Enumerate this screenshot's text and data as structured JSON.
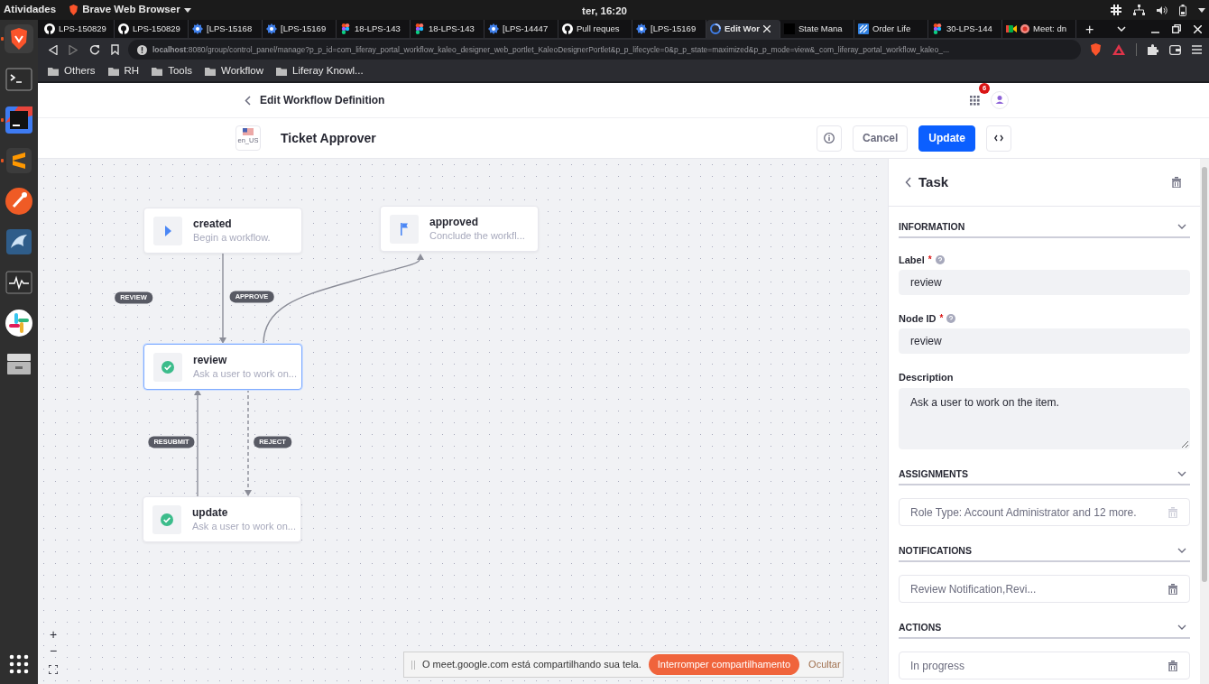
{
  "system_bar": {
    "activities": "Atividades",
    "app_menu": "Brave Web Browser",
    "clock": "ter, 16:20"
  },
  "dock": [
    {
      "kind": "brave",
      "running": true
    },
    {
      "kind": "terminal",
      "running": false
    },
    {
      "kind": "ide",
      "running": true
    },
    {
      "kind": "editor",
      "running": true
    },
    {
      "kind": "round",
      "running": false
    },
    {
      "kind": "database",
      "running": false
    },
    {
      "kind": "monitor",
      "running": false
    },
    {
      "kind": "pinwheel",
      "running": false
    },
    {
      "kind": "drawer",
      "running": false
    }
  ],
  "browser": {
    "tabs": [
      {
        "title": "LPS-150829",
        "kind": "github",
        "selected": false
      },
      {
        "title": "LPS-150829",
        "kind": "github",
        "selected": false
      },
      {
        "title": "[LPS-15168",
        "kind": "gear",
        "selected": false
      },
      {
        "title": "[LPS-15169",
        "kind": "gear",
        "selected": false
      },
      {
        "title": "18-LPS-143",
        "kind": "figma",
        "selected": false
      },
      {
        "title": "18-LPS-143",
        "kind": "figma",
        "selected": false
      },
      {
        "title": "[LPS-14447",
        "kind": "gear",
        "selected": false
      },
      {
        "title": "Pull reques",
        "kind": "github",
        "selected": false
      },
      {
        "title": "[LPS-15169",
        "kind": "gear",
        "selected": false
      },
      {
        "title": "Edit Wor",
        "kind": "spinner",
        "selected": true
      },
      {
        "title": "State Mana",
        "kind": "blank",
        "selected": false
      },
      {
        "title": "Order Life",
        "kind": "grid",
        "selected": false
      },
      {
        "title": "30-LPS-144",
        "kind": "figma",
        "selected": false
      },
      {
        "title": "Meet: dn",
        "kind": "meet",
        "selected": false
      }
    ],
    "new_tab": "+",
    "url": "**localhost**:8080/group/control_panel/manage?p_p_id=com_liferay_portal_workflow_kaleo_designer_web_portlet_KaleoDesignerPortlet&p_p_lifecycle=0&p_p_state=maximized&p_p_mode=view&_com_liferay_portal_workflow_kaleo_...",
    "bookmarks": [
      "Others",
      "RH",
      "Tools",
      "Workflow",
      "Liferay Knowl..."
    ]
  },
  "page": {
    "header_title": "Edit Workflow Definition",
    "notification_count": "6",
    "locale": "en_US",
    "title": "Ticket Approver",
    "cancel": "Cancel",
    "update": "Update"
  },
  "canvas": {
    "nodes": [
      {
        "kind": "start",
        "label": "created",
        "description": "Begin a workflow.",
        "selected": false
      },
      {
        "kind": "end",
        "label": "approved",
        "description": "Conclude the workfl...",
        "selected": false
      },
      {
        "kind": "task",
        "label": "review",
        "description": "Ask a user to work on...",
        "selected": true
      },
      {
        "kind": "task",
        "label": "update",
        "description": "Ask a user to work on...",
        "selected": false
      }
    ],
    "transitions": [
      {
        "label": "REVIEW",
        "kind": "solid"
      },
      {
        "label": "APPROVE",
        "kind": "solid"
      },
      {
        "label": "REJECT",
        "kind": "dashed"
      },
      {
        "label": "RESUBMIT",
        "kind": "solid"
      }
    ],
    "zoom_controls": [
      "+",
      "−"
    ]
  },
  "panel": {
    "title": "Task",
    "information": {
      "title": "INFORMATION",
      "fields": [
        {
          "label": "Label",
          "required_mark": "*",
          "help": true,
          "kind": "input",
          "value": "review"
        },
        {
          "label": "Node ID",
          "required_mark": "*",
          "help": true,
          "kind": "input",
          "value": "review"
        },
        {
          "label": "Description",
          "help": false,
          "kind": "textarea",
          "value": "Ask a user to work on the item."
        }
      ]
    },
    "lists": [
      {
        "title": "ASSIGNMENTS",
        "item": "Role Type:  Account Administrator  and 12 more.",
        "delete_disabled": true
      },
      {
        "title": "NOTIFICATIONS",
        "item": "Review Notification,Revi...",
        "delete_disabled": false
      },
      {
        "title": "ACTIONS",
        "item": "In progress",
        "delete_disabled": false
      }
    ]
  },
  "share_bar": {
    "message": "O meet.google.com está compartilhando sua tela.",
    "stop": "Interromper compartilhamento",
    "hide": "Ocultar"
  }
}
